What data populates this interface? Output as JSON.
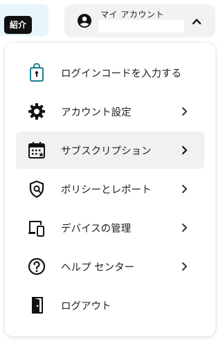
{
  "header": {
    "promo_badge": "紹介",
    "account_label": "マイ アカウント",
    "account_icon": "account-circle-icon",
    "toggle_icon": "chevron-up-icon"
  },
  "menu": {
    "items": [
      {
        "label": "ログインコードを入力する",
        "icon": "login-code-icon",
        "has_chevron": false,
        "active": false
      },
      {
        "label": "アカウント設定",
        "icon": "gear-icon",
        "has_chevron": true,
        "active": false
      },
      {
        "label": "サブスクリプション",
        "icon": "subscription-calendar-icon",
        "has_chevron": true,
        "active": true
      },
      {
        "label": "ポリシーとレポート",
        "icon": "policy-shield-icon",
        "has_chevron": true,
        "active": false
      },
      {
        "label": "デバイスの管理",
        "icon": "devices-icon",
        "has_chevron": true,
        "active": false
      },
      {
        "label": "ヘルプ センター",
        "icon": "help-icon",
        "has_chevron": true,
        "active": false
      },
      {
        "label": "ログアウト",
        "icon": "logout-door-icon",
        "has_chevron": false,
        "active": false
      }
    ]
  },
  "colors": {
    "promo_area_bg": "#e7f6fa",
    "login_icon_accent": "#1a7f8c",
    "active_item_bg": "#f1f1f2",
    "account_button_bg": "#f1f2f3"
  }
}
